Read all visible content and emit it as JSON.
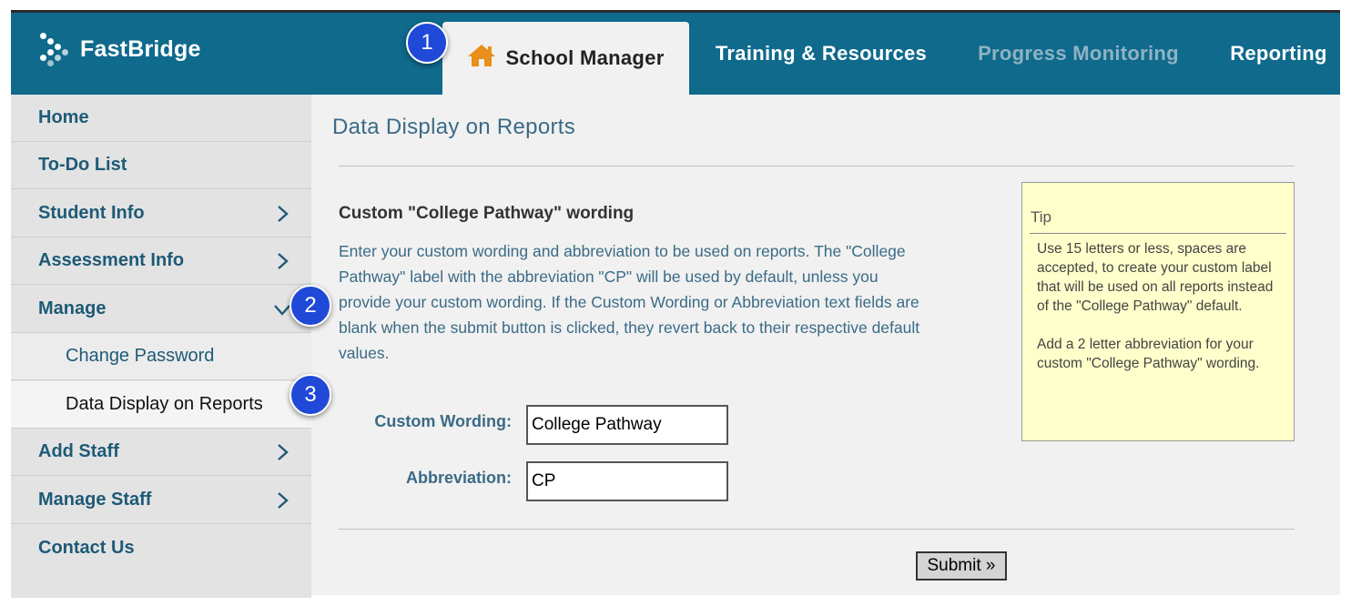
{
  "header": {
    "brand": "FastBridge",
    "tabs": [
      {
        "label": "School Manager",
        "active": true
      },
      {
        "label": "Training & Resources",
        "active": false
      },
      {
        "label": "Progress Monitoring",
        "active": false,
        "disabled": true
      },
      {
        "label": "Reporting",
        "active": false
      }
    ]
  },
  "sidebar": {
    "items": [
      {
        "label": "Home"
      },
      {
        "label": "To-Do List"
      },
      {
        "label": "Student Info"
      },
      {
        "label": "Assessment Info"
      },
      {
        "label": "Manage"
      },
      {
        "label": "Change Password"
      },
      {
        "label": "Data Display on Reports"
      },
      {
        "label": "Add Staff"
      },
      {
        "label": "Manage Staff"
      },
      {
        "label": "Contact Us"
      }
    ]
  },
  "main": {
    "title": "Data Display on Reports",
    "section_heading": "Custom \"College Pathway\" wording",
    "description": "Enter your custom wording and abbreviation to be used on reports. The \"College Pathway\" label with the abbreviation \"CP\" will be used by default, unless you provide your custom wording. If the Custom Wording or Abbreviation text fields are blank when the submit button is clicked, they revert back to their respective default values.",
    "custom_wording_label": "Custom Wording:",
    "custom_wording_value": "College Pathway",
    "abbreviation_label": "Abbreviation:",
    "abbreviation_value": "CP",
    "submit_label": "Submit »"
  },
  "tip": {
    "title": "Tip",
    "paragraph1": "Use 15 letters or less, spaces are accepted, to create your custom label that will be used on all reports instead of the \"College Pathway\" default.",
    "paragraph2": "Add a 2 letter abbreviation for your custom \"College Pathway\" wording."
  },
  "callouts": [
    "1",
    "2",
    "3"
  ],
  "colors": {
    "header_bg": "#0f6a8c",
    "sidebar_bg": "#e3e3e3",
    "link_text": "#1e5a77",
    "tip_bg": "#ffffcc",
    "callout": "#1f49d6",
    "home_icon": "#e8901a"
  }
}
